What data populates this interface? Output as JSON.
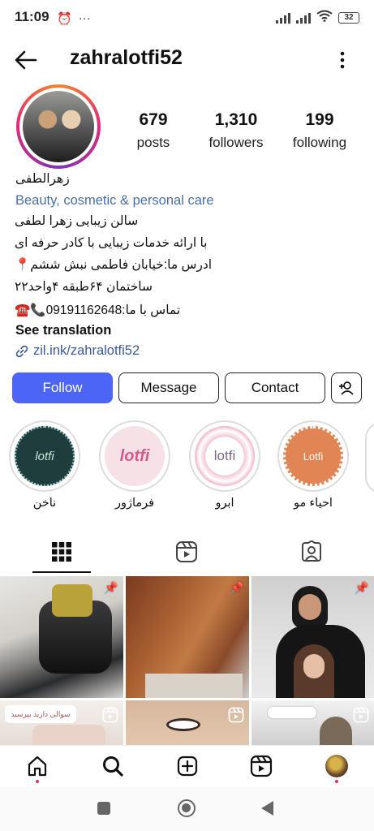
{
  "status_bar": {
    "time": "11:09",
    "alarm_icon": "alarm-icon",
    "more": "···",
    "battery": "32"
  },
  "header": {
    "username": "zahralotfi52",
    "back_icon": "arrow-left-icon",
    "menu_icon": "kebab-icon"
  },
  "stats": [
    {
      "value": "679",
      "label": "posts"
    },
    {
      "value": "1,310",
      "label": "followers"
    },
    {
      "value": "199",
      "label": "following"
    }
  ],
  "bio": {
    "name": "زهرالطفی",
    "category": "Beauty, cosmetic & personal care",
    "lines": [
      "سالن زیبایی زهرا لطفی",
      "با ارائه خدمات زیبایی با کادر حرفه ای",
      "ادرس ما:خیابان فاطمی نبش ششم📍",
      "ساختمان ۶۴طبقه ۴واحد۲۲",
      "تماس با ما:09191162648📞☎️"
    ],
    "see_translation": "See translation",
    "link": "zil.ink/zahralotfi52"
  },
  "buttons": {
    "follow": "Follow",
    "message": "Message",
    "contact": "Contact"
  },
  "highlights": [
    {
      "name": "ناخن",
      "cover_text": "lotfi",
      "bg": "#1f3d3c",
      "fg": "#cfe6d8"
    },
    {
      "name": "فرماژور",
      "cover_text": "lotfi",
      "bg": "#f6e1e6",
      "fg": "#d45a8a"
    },
    {
      "name": "ابرو",
      "cover_text": "lotfi",
      "bg": "#ffffff",
      "fg": "#7a6a8a"
    },
    {
      "name": "احیاء مو",
      "cover_text": "Lotfi",
      "bg": "#e28554",
      "fg": "#ffffff"
    }
  ],
  "grid": {
    "tile_labels": [
      "سوالی دارید بپرسید"
    ]
  },
  "colors": {
    "accent": "#4d65f7",
    "link": "#3b5998",
    "category": "#4a6fa5"
  }
}
